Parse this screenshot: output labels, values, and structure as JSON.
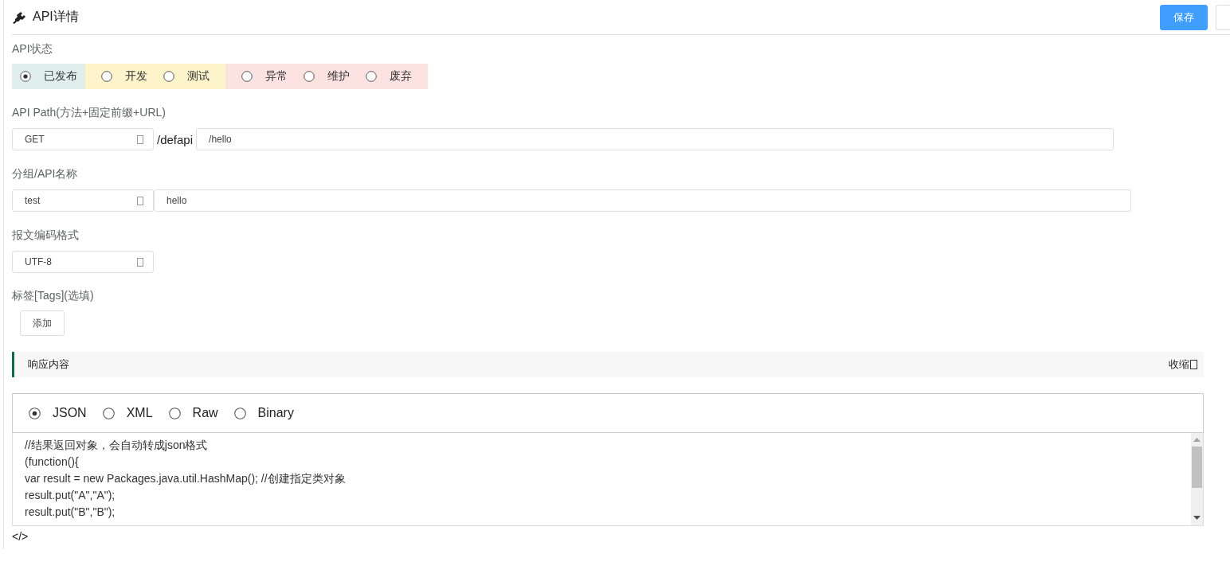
{
  "header": {
    "title": "API详情",
    "buttons": [
      {
        "label": "保存",
        "kind": "primary"
      },
      {
        "kind": "plain"
      }
    ]
  },
  "status": {
    "label": "API状态",
    "options": [
      {
        "label": "已发布",
        "selected": true,
        "color": "#e1efec"
      },
      {
        "label": "开发",
        "selected": false,
        "color": "#fdf4cc"
      },
      {
        "label": "测试",
        "selected": false,
        "color": "#fdf4cc"
      },
      {
        "label": "异常",
        "selected": false,
        "color": "#fde2e2"
      },
      {
        "label": "维护",
        "selected": false,
        "color": "#fde2e2"
      },
      {
        "label": "废弃",
        "selected": false,
        "color": "#fde2e2"
      }
    ]
  },
  "fields": [
    {
      "label": "API Path(方法+固定前缀+URL)",
      "select": "GET",
      "prefix": "/defapi",
      "input": "/hello",
      "kind": "path"
    },
    {
      "label": "分组/API名称",
      "select": "test",
      "input": "hello",
      "kind": "name"
    },
    {
      "label": "报文编码格式",
      "select": "UTF-8",
      "kind": "select"
    }
  ],
  "tags": {
    "label": "标签[Tags](选填)",
    "button": "添加"
  },
  "response": {
    "title": "响应内容",
    "toggle": "收缩",
    "formats": [
      {
        "label": "JSON",
        "selected": true
      },
      {
        "label": "XML",
        "selected": false
      },
      {
        "label": "Raw",
        "selected": false
      },
      {
        "label": "Binary",
        "selected": false
      }
    ],
    "code": [
      "//结果返回对象，会自动转成json格式",
      "(function(){",
      "var result = new Packages.java.util.HashMap(); //创建指定类对象",
      "result.put(\"A\",\"A\");",
      "result.put(\"B\",\"B\");"
    ],
    "footer": "</>"
  }
}
